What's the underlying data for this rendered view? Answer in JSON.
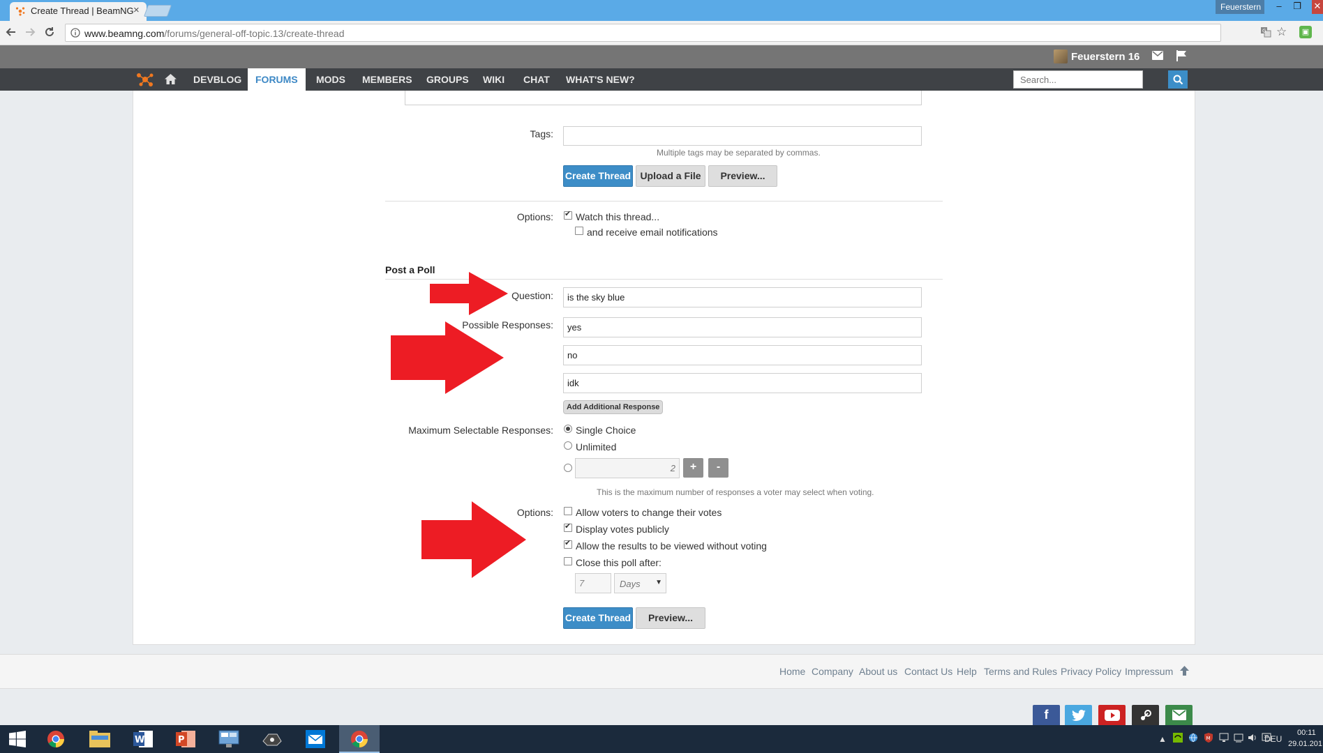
{
  "browser": {
    "tab_title": "Create Thread | BeamNG",
    "url_host": "www.beamng.com",
    "url_path": "/forums/general-off-topic.13/create-thread",
    "profile_name": "Feuerstern"
  },
  "site": {
    "username": "Feuerstern 16",
    "nav": [
      "DEVBLOG",
      "FORUMS",
      "MODS",
      "MEMBERS",
      "GROUPS",
      "WIKI",
      "CHAT",
      "WHAT'S NEW?"
    ],
    "active_nav": "FORUMS",
    "search_placeholder": "Search..."
  },
  "form": {
    "tags_label": "Tags:",
    "tags_value": "",
    "tags_hint": "Multiple tags may be separated by commas.",
    "create_thread_label": "Create Thread",
    "upload_label": "Upload a File",
    "preview_label": "Preview...",
    "options_label": "Options:",
    "watch_label": "Watch this thread...",
    "watch_checked": true,
    "email_label": "and receive email notifications",
    "email_checked": false
  },
  "poll": {
    "section_title": "Post a Poll",
    "question_label": "Question:",
    "question_value": "is the sky blue",
    "responses_label": "Possible Responses:",
    "responses": [
      "yes",
      "no",
      "idk"
    ],
    "add_response_label": "Add Additional Response",
    "max_label": "Maximum Selectable Responses:",
    "single_choice_label": "Single Choice",
    "unlimited_label": "Unlimited",
    "max_selected": "Single Choice",
    "max_number_value": "2",
    "plus_label": "+",
    "minus_label": "-",
    "max_hint": "This is the maximum number of responses a voter may select when voting.",
    "options_label": "Options:",
    "options": [
      {
        "label": "Allow voters to change their votes",
        "checked": false
      },
      {
        "label": "Display votes publicly",
        "checked": true
      },
      {
        "label": "Allow the results to be viewed without voting",
        "checked": true
      },
      {
        "label": "Close this poll after:",
        "checked": false
      }
    ],
    "close_after_value": "7",
    "close_after_unit": "Days",
    "create_thread_label": "Create Thread",
    "preview_label": "Preview..."
  },
  "annotations": {
    "arrow_color": "#ed1c24"
  },
  "footer": {
    "links": [
      "Home",
      "Company",
      "About us",
      "Contact Us",
      "Help",
      "Terms and Rules",
      "Privacy Policy",
      "Impressum"
    ],
    "social": [
      "facebook-icon",
      "twitter-icon",
      "youtube-icon",
      "steam-icon",
      "mail-icon"
    ]
  },
  "taskbar": {
    "apps": [
      "windows-start-icon",
      "chrome-icon",
      "file-explorer-icon",
      "word-icon",
      "powerpoint-icon",
      "remote-desktop-icon",
      "game-icon",
      "mail-icon",
      "chrome-active-icon"
    ],
    "language": "DEU",
    "time": "00:11",
    "date": "29.01.201"
  },
  "colors": {
    "accent": "#3d8dc7",
    "nav_bg": "#3f4246",
    "topbar_bg": "#757575",
    "titlebar": "#5aaae7"
  }
}
